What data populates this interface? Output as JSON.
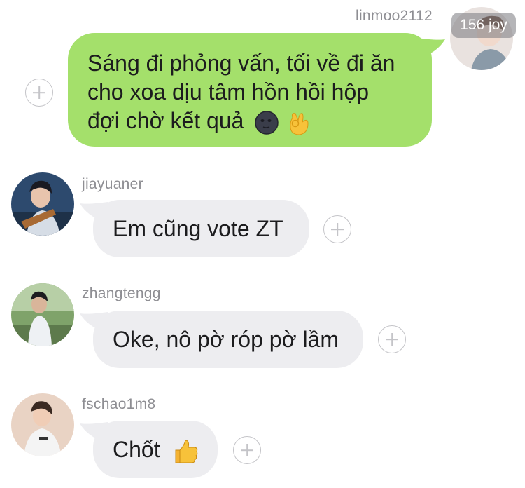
{
  "messages": [
    {
      "username": "linmoo2112",
      "text_lines": [
        "Sáng đi phỏng vấn, tối về đi ăn",
        "cho xoa dịu tâm hồn hồi hộp",
        "đợi chờ kết quả"
      ],
      "emojis": [
        "new-moon-face-icon",
        "ok-hand-icon"
      ],
      "direction": "outgoing"
    },
    {
      "username": "jiayuaner",
      "text": "Em cũng vote ZT",
      "direction": "incoming"
    },
    {
      "username": "zhangtengg",
      "text": "Oke, nô pờ róp pờ lầm",
      "direction": "incoming"
    },
    {
      "username": "fschao1m8",
      "text": "Chốt",
      "emojis": [
        "thumbs-up-icon"
      ],
      "direction": "incoming"
    }
  ],
  "watermark": "156 joy",
  "colors": {
    "outgoing_bubble": "#a4e06b",
    "incoming_bubble": "#ededf0",
    "username_text": "#8e8e93",
    "plus_outline": "#c4c4c8"
  }
}
